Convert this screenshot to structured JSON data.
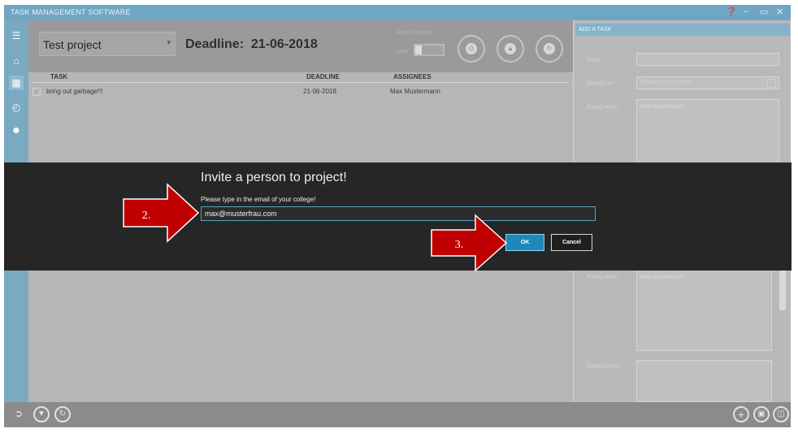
{
  "window": {
    "title": "TASK MANAGEMENT SOFTWARE",
    "help_icon": "question-circle-icon",
    "minimize_icon": "minimize-icon",
    "maximize_icon": "restore-icon",
    "close_icon": "close-icon"
  },
  "nav": {
    "items": [
      {
        "icon": "hamburger-menu-icon"
      },
      {
        "icon": "home-icon"
      },
      {
        "icon": "board-icon"
      },
      {
        "icon": "calendar-icon"
      },
      {
        "icon": "user-icon"
      }
    ]
  },
  "header": {
    "project_select": "Test project",
    "deadline_label": "Deadline:",
    "deadline_value": "21-06-2018",
    "toggle_label_top": "Hide Finished",
    "toggle_label_left": "OFF"
  },
  "tasklist": {
    "columns": [
      "TASK",
      "DEADLINE",
      "ASSIGNEES"
    ],
    "rows": [
      {
        "task": "bring out garbage!!!",
        "deadline": "21-06-2018",
        "assignees": "Max Mustermann",
        "done": true
      }
    ]
  },
  "add_task": {
    "header": "ADD A TASK",
    "task_label": "Task:",
    "deadline_label": "Deadline:",
    "deadline_placeholder": "Please select a date",
    "assignees_label": "Assignees:",
    "assignees_value": "Max Mustermann",
    "assignees_label_2": "Assignees:",
    "assignees_value_2": "Max Mustermann",
    "description_label": "Description:"
  },
  "dialog": {
    "title": "Invite a person to project!",
    "prompt": "Please type in the email of your college!",
    "email_value": "max@musterfrau.com",
    "ok_label": "OK",
    "cancel_label": "Cancel"
  },
  "callouts": {
    "step2_label": "2.",
    "step3_label": "3."
  },
  "colors": {
    "accent": "#1e88b8",
    "callout_red": "#c00000",
    "dialog_bg": "#262626"
  }
}
